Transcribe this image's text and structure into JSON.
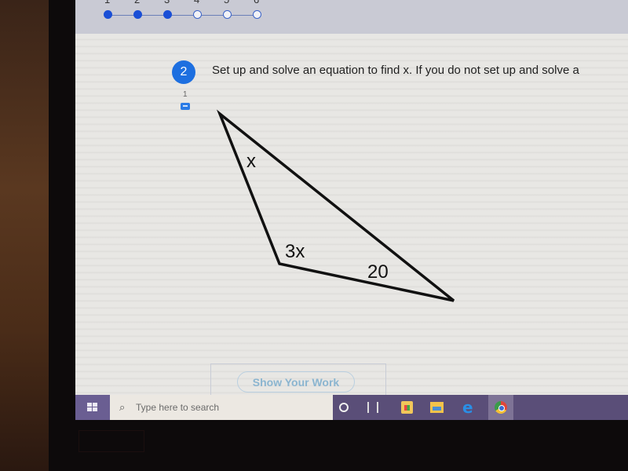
{
  "progress": {
    "steps": [
      {
        "label": "1",
        "completed": true
      },
      {
        "label": "2",
        "completed": true
      },
      {
        "label": "3",
        "completed": true
      },
      {
        "label": "4",
        "completed": false
      },
      {
        "label": "5",
        "completed": false
      },
      {
        "label": "6",
        "completed": false
      }
    ],
    "completed_count": 3,
    "total": 6
  },
  "question": {
    "number": "2",
    "text": "Set up and solve an equation to find x. If you do not set up and solve a",
    "comment_count": "1"
  },
  "figure": {
    "type": "triangle",
    "angle_labels": {
      "top": "x",
      "left": "3x",
      "right": "20"
    }
  },
  "actions": {
    "show_work_label": "Show Your Work"
  },
  "taskbar": {
    "search_placeholder": "Type here to search",
    "icons": [
      "windows-start-icon",
      "search-icon",
      "cortana-icon",
      "task-view-icon",
      "store-icon",
      "file-explorer-icon",
      "edge-icon",
      "chrome-icon"
    ]
  },
  "colors": {
    "accent": "#1d6fe0",
    "progress_done": "#1a4fd6",
    "taskbar": "#5a4e78"
  }
}
